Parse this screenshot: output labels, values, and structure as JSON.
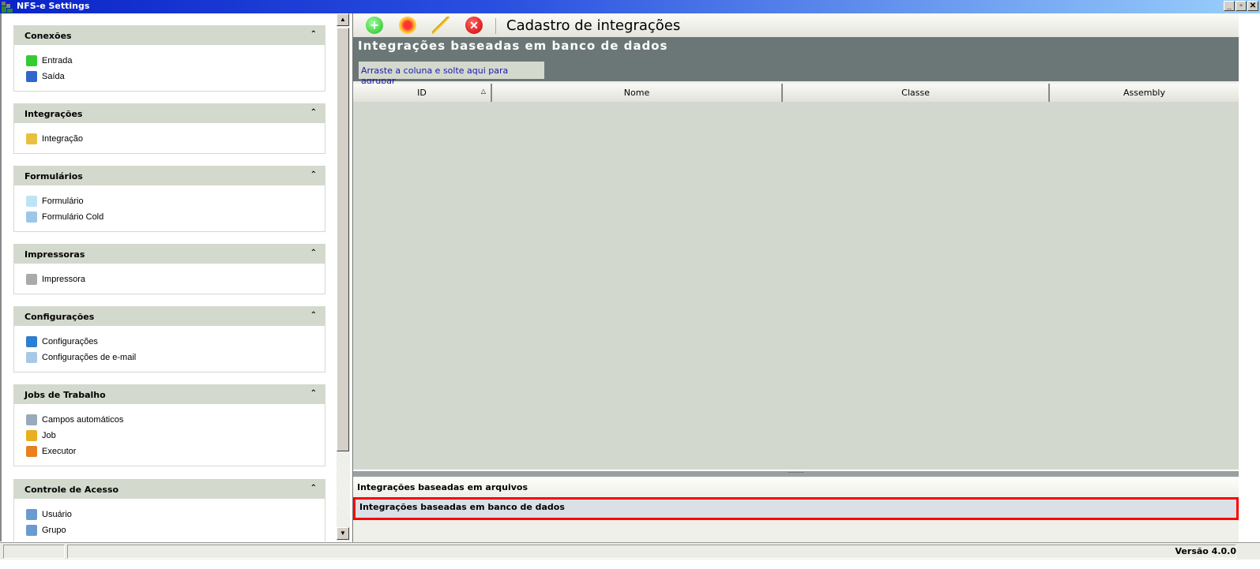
{
  "window": {
    "title": "NFS-e Settings"
  },
  "sidebar": {
    "groups": [
      {
        "title": "Conexões",
        "items": [
          {
            "label": "Entrada",
            "icon": "connection-in-icon",
            "color": "#3c3"
          },
          {
            "label": "Saída",
            "icon": "connection-out-icon",
            "color": "#36c"
          }
        ]
      },
      {
        "title": "Integrações",
        "items": [
          {
            "label": "Integração",
            "icon": "integration-icon",
            "color": "#e8c040"
          }
        ]
      },
      {
        "title": "Formulários",
        "items": [
          {
            "label": "Formulário",
            "icon": "form-icon",
            "color": "#bfe3f5"
          },
          {
            "label": "Formulário Cold",
            "icon": "form-cold-icon",
            "color": "#9cc8e8"
          }
        ]
      },
      {
        "title": "Impressoras",
        "items": [
          {
            "label": "Impressora",
            "icon": "printer-icon",
            "color": "#aaa"
          }
        ]
      },
      {
        "title": "Configurações",
        "items": [
          {
            "label": "Configurações",
            "icon": "settings-icon",
            "color": "#2a7fd0"
          },
          {
            "label": "Configurações de e-mail",
            "icon": "email-icon",
            "color": "#a8c8e8"
          }
        ]
      },
      {
        "title": "Jobs de Trabalho",
        "items": [
          {
            "label": "Campos automáticos",
            "icon": "auto-fields-icon",
            "color": "#9ab"
          },
          {
            "label": "Job",
            "icon": "job-icon",
            "color": "#e8b020"
          },
          {
            "label": "Executor",
            "icon": "executor-icon",
            "color": "#e88020"
          }
        ]
      },
      {
        "title": "Controle de Acesso",
        "items": [
          {
            "label": "Usuário",
            "icon": "user-icon",
            "color": "#6a9ad0"
          },
          {
            "label": "Grupo",
            "icon": "group-icon",
            "color": "#6a9ad0"
          }
        ]
      }
    ]
  },
  "toolbar": {
    "title": "Cadastro de integrações"
  },
  "main": {
    "section_title": "Integrações baseadas em banco de dados",
    "group_hint": "Arraste a coluna e solte aqui para agrupar",
    "columns": [
      "ID",
      "Nome",
      "Classe",
      "Assembly"
    ],
    "nav": [
      "Integrações baseadas em arquivos",
      "Integrações baseadas em banco de dados"
    ]
  },
  "status": {
    "version": "Versão 4.0.0"
  }
}
